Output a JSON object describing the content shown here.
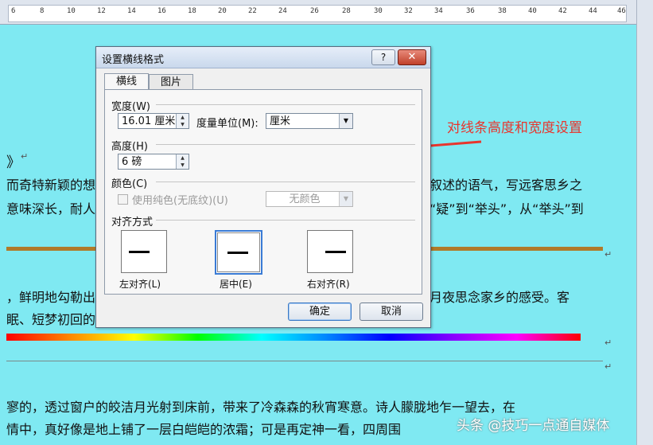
{
  "ruler": {
    "labels": [
      "6",
      "8",
      "10",
      "12",
      "14",
      "16",
      "18",
      "20",
      "22",
      "24",
      "26",
      "28",
      "30",
      "32",
      "34",
      "36",
      "38",
      "40",
      "42",
      "44",
      "46"
    ]
  },
  "document": {
    "heading_fragment": "》",
    "line1_left": "而奇特新颖的想",
    "line1_right": "叙述的语气，写远客思乡之",
    "line2_left": "意味深长，耐人",
    "line2_right": "“疑”到“举头”，从“举头”到",
    "line3_left": "，鲜明地勾勒出",
    "line3_right": "月夜思念家乡的感受。客",
    "line4_left": "眠、短梦初回的",
    "line5": "寥的，透过窗户的皎洁月光射到床前，带来了冷森森的秋宵寒意。诗人朦胧地乍一望去，在",
    "line6": "情中，真好像是地上铺了一层白皑皑的浓霜；可是再定神一看，四周围",
    "para_mark": "↵",
    "heading_mark": "↵"
  },
  "annotation": {
    "text": "对线条高度和宽度设置",
    "color": "#e8352d"
  },
  "watermark": {
    "text": "头条 @技巧一点通自媒体"
  },
  "dialog": {
    "title": "设置横线格式",
    "help_label": "?",
    "close_label": "✕",
    "tabs": [
      {
        "label": "横线"
      },
      {
        "label": "图片"
      }
    ],
    "width": {
      "section": "宽度(W)",
      "value": "16.01 厘米",
      "unit_label": "度量单位(M):",
      "unit_value": "厘米"
    },
    "height": {
      "section": "高度(H)",
      "value": "6 磅"
    },
    "color": {
      "section": "颜色(C)",
      "checkbox_label": "使用纯色(无底纹)(U)",
      "value": "无颜色"
    },
    "alignment": {
      "section": "对齐方式",
      "options": [
        {
          "label": "左对齐(L)"
        },
        {
          "label": "居中(E)"
        },
        {
          "label": "右对齐(R)"
        }
      ],
      "selected": "居中(E)"
    },
    "ok_label": "确定",
    "cancel_label": "取消"
  }
}
